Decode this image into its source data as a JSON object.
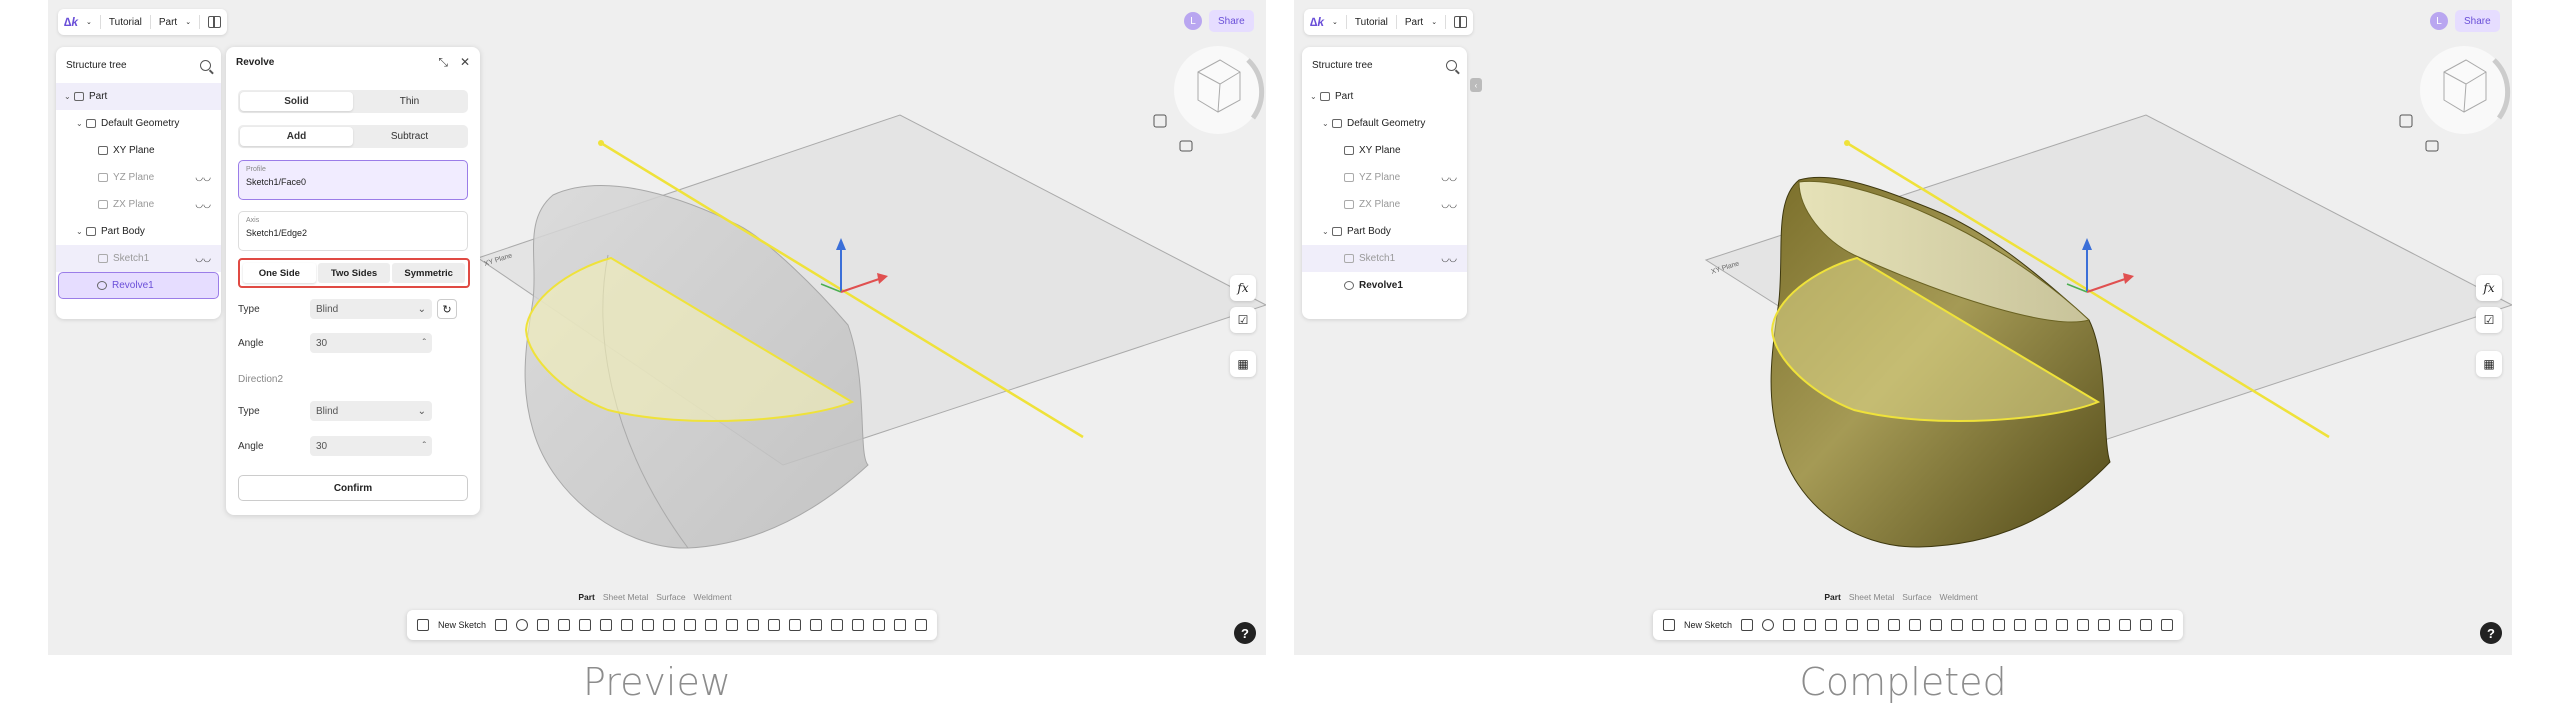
{
  "panels": [
    {
      "caption": "Preview",
      "topbar": {
        "logo": "∆k",
        "crumb1": "Tutorial",
        "crumb2": "Part"
      },
      "avatar": "L",
      "share": "Share",
      "tree": {
        "title": "Structure tree",
        "items": [
          {
            "label": "Part"
          },
          {
            "label": "Default Geometry"
          },
          {
            "label": "XY Plane"
          },
          {
            "label": "YZ Plane"
          },
          {
            "label": "ZX Plane"
          },
          {
            "label": "Part Body"
          },
          {
            "label": "Sketch1"
          },
          {
            "label": "Revolve1"
          }
        ]
      },
      "revolve": {
        "title": "Revolve",
        "solid": "Solid",
        "thin": "Thin",
        "add": "Add",
        "subtract": "Subtract",
        "profile_label": "Profile",
        "profile_value": "Sketch1/Face0",
        "axis_label": "Axis",
        "axis_value": "Sketch1/Edge2",
        "one_side": "One Side",
        "two_sides": "Two Sides",
        "symmetric": "Symmetric",
        "type_label": "Type",
        "type_value": "Blind",
        "angle_label": "Angle",
        "angle_value": "30",
        "direction2": "Direction2",
        "type2_label": "Type",
        "type2_value": "Blind",
        "angle2_label": "Angle",
        "angle2_value": "30",
        "confirm": "Confirm"
      },
      "plane_label": "XY Plane",
      "mode_tabs": [
        "Part",
        "Sheet Metal",
        "Surface",
        "Weldment"
      ],
      "new_sketch": "New Sketch",
      "fx": "fx",
      "help": "?"
    },
    {
      "caption": "Completed",
      "topbar": {
        "logo": "∆k",
        "crumb1": "Tutorial",
        "crumb2": "Part"
      },
      "avatar": "L",
      "share": "Share",
      "tree": {
        "title": "Structure tree",
        "items": [
          {
            "label": "Part"
          },
          {
            "label": "Default Geometry"
          },
          {
            "label": "XY Plane"
          },
          {
            "label": "YZ Plane"
          },
          {
            "label": "ZX Plane"
          },
          {
            "label": "Part Body"
          },
          {
            "label": "Sketch1"
          },
          {
            "label": "Revolve1"
          }
        ]
      },
      "plane_label": "XY Plane",
      "mode_tabs": [
        "Part",
        "Sheet Metal",
        "Surface",
        "Weldment"
      ],
      "new_sketch": "New Sketch",
      "fx": "fx",
      "help": "?"
    }
  ],
  "colors": {
    "accent": "#6a4fd8",
    "highlight": "#e04a43",
    "sketch": "#f0e23c"
  }
}
